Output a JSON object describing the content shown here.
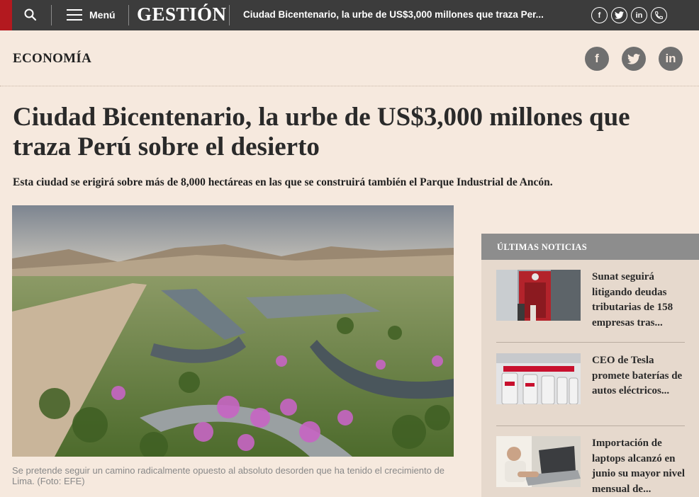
{
  "topbar": {
    "menu_label": "Menú",
    "logo": "GESTIÓN",
    "headline": "Ciudad Bicentenario, la urbe de US$3,000 millones que traza Per...",
    "social": [
      {
        "icon": "facebook-icon",
        "glyph": "f"
      },
      {
        "icon": "twitter-icon",
        "glyph": "t"
      },
      {
        "icon": "linkedin-icon",
        "glyph": "in"
      },
      {
        "icon": "phone-icon",
        "glyph": "☏"
      }
    ]
  },
  "section": {
    "label": "ECONOMÍA"
  },
  "share": [
    {
      "icon": "facebook-icon",
      "glyph": "f"
    },
    {
      "icon": "twitter-icon",
      "glyph": "t"
    },
    {
      "icon": "linkedin-icon",
      "glyph": "in"
    }
  ],
  "article": {
    "title": "Ciudad Bicentenario, la urbe de US$3,000 millones que traza Perú sobre el desierto",
    "subtitle": "Esta ciudad se erigirá sobre más de 8,000 hectáreas en las que se construirá también el Parque Industrial de Ancón.",
    "caption": "Se pretende seguir un camino radicalmente opuesto al absoluto desorden que ha tenido el crecimiento de Lima. (Foto: EFE)"
  },
  "sidebar": {
    "header": "ÚLTIMAS NOTICIAS",
    "items": [
      {
        "title": "Sunat seguirá litigando deudas tributarias de 158 empresas tras..."
      },
      {
        "title": "CEO de Tesla promete baterías de autos eléctricos..."
      },
      {
        "title": "Importación de laptops alcanzó en junio su mayor nivel mensual de..."
      }
    ]
  },
  "colors": {
    "background": "#f6e9de",
    "topbar": "#3c3c3c",
    "brand_red": "#b3191f",
    "sidebar_bg": "#e6d9cd",
    "sidebar_header": "#8d8d8d"
  }
}
